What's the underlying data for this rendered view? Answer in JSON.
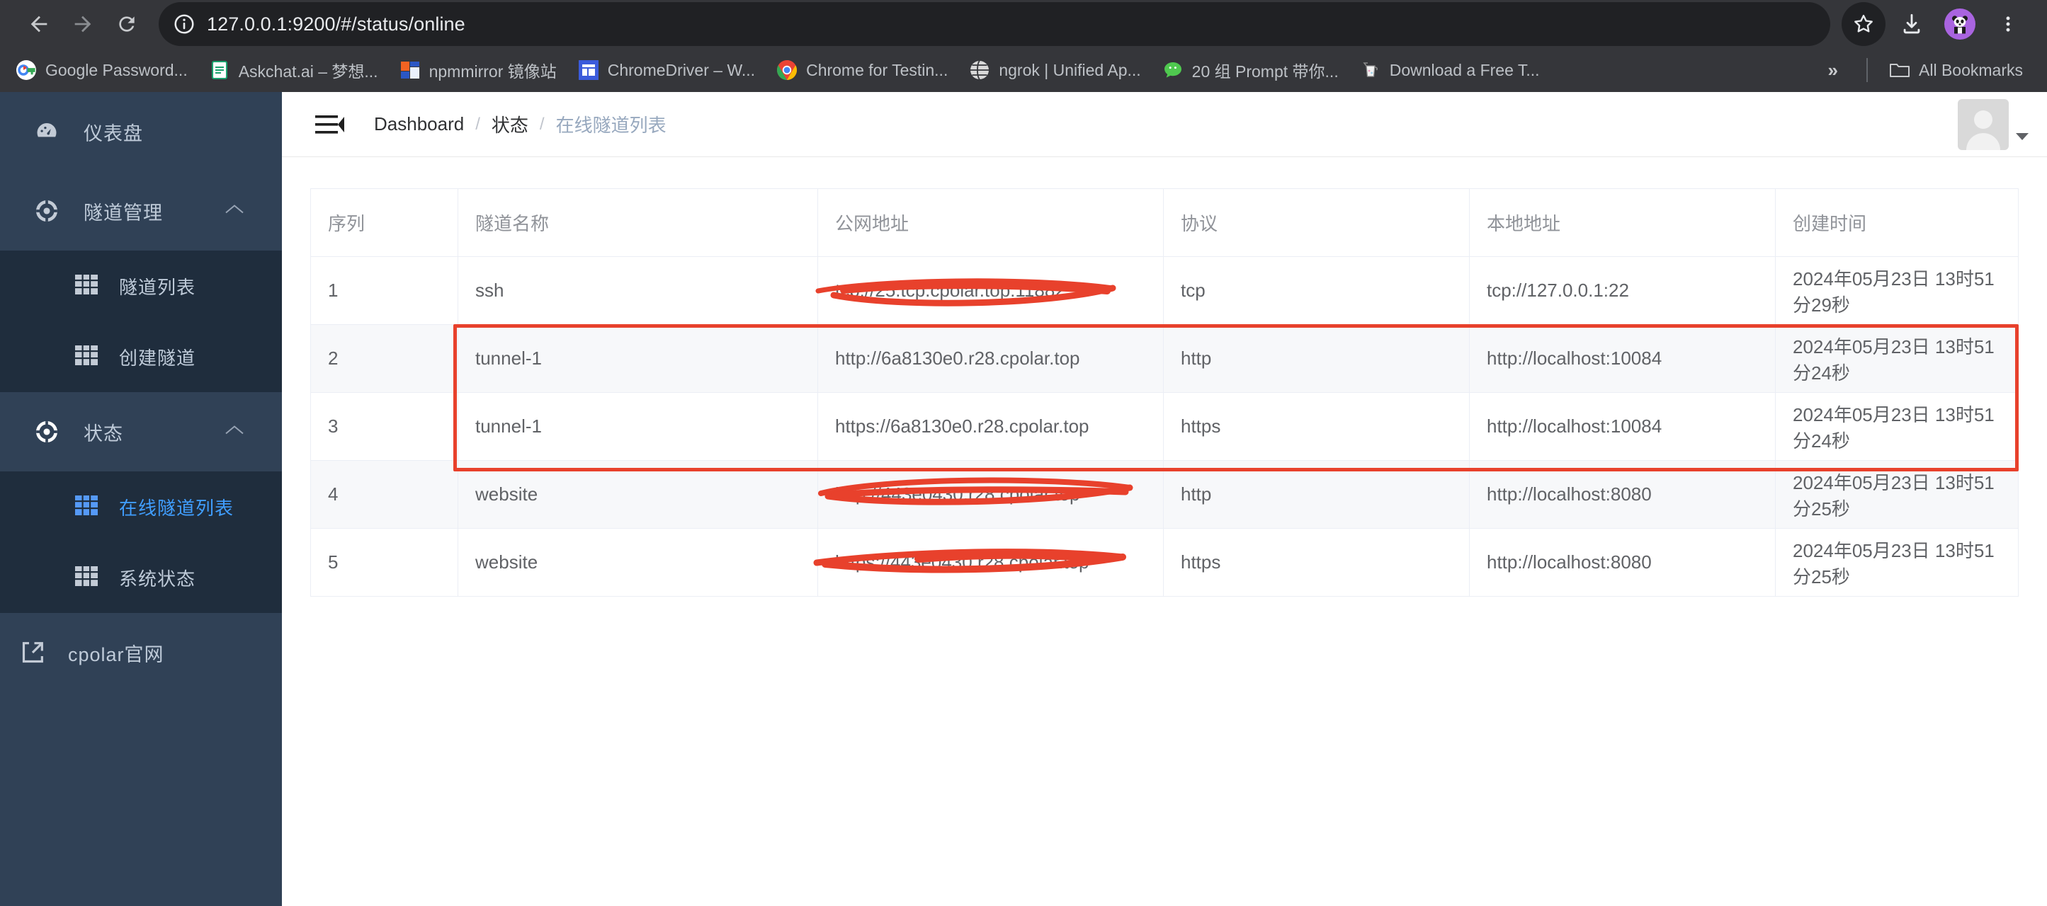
{
  "browser": {
    "url": "127.0.0.1:9200/#/status/online",
    "back_label": "Back",
    "forward_label": "Forward",
    "reload_label": "Reload",
    "site_info_label": "View site information",
    "bookmark_star_label": "Bookmark this tab",
    "downloads_label": "Downloads",
    "profile_label": "Profile",
    "menu_label": "Customize and control Google Chrome",
    "bookmarks": [
      {
        "label": "Google Password...",
        "icon": "google-password-icon"
      },
      {
        "label": "Askchat.ai – 梦想...",
        "icon": "askchat-doc-icon"
      },
      {
        "label": "npmmirror 镜像站",
        "icon": "npmmirror-icon"
      },
      {
        "label": "ChromeDriver – W...",
        "icon": "chromedriver-icon"
      },
      {
        "label": "Chrome for Testin...",
        "icon": "chrome-icon"
      },
      {
        "label": "ngrok | Unified Ap...",
        "icon": "ngrok-globe-icon"
      },
      {
        "label": "20 组 Prompt 带你...",
        "icon": "wechat-icon"
      },
      {
        "label": "Download a Free T...",
        "icon": "teapot-icon"
      }
    ],
    "overflow_label": "»",
    "all_bookmarks_label": "All Bookmarks"
  },
  "sidebar": {
    "dashboard": {
      "label": "仪表盘",
      "icon": "dashboard-gauge-icon"
    },
    "groups": [
      {
        "label": "隧道管理",
        "icon": "tunnel-manage-icon",
        "expanded": true,
        "arrow": "chevron-up-icon",
        "items": [
          {
            "label": "隧道列表",
            "icon": "grid-icon",
            "active": false
          },
          {
            "label": "创建隧道",
            "icon": "grid-icon",
            "active": false
          }
        ]
      },
      {
        "label": "状态",
        "icon": "status-icon",
        "expanded": true,
        "arrow": "chevron-up-icon",
        "items": [
          {
            "label": "在线隧道列表",
            "icon": "grid-icon",
            "active": true
          },
          {
            "label": "系统状态",
            "icon": "grid-icon",
            "active": false
          }
        ]
      }
    ],
    "external": {
      "label": "cpolar官网",
      "icon": "external-link-icon"
    }
  },
  "topbar": {
    "menu_toggle": "hamburger-fold-icon",
    "breadcrumbs": [
      {
        "label": "Dashboard",
        "current": false
      },
      {
        "label": "状态",
        "current": false
      },
      {
        "label": "在线隧道列表",
        "current": true
      }
    ],
    "separator": "/",
    "avatar_label": "user-avatar"
  },
  "table": {
    "columns": [
      "序列",
      "隧道名称",
      "公网地址",
      "协议",
      "本地地址",
      "创建时间"
    ],
    "rows": [
      {
        "seq": "1",
        "name": "ssh",
        "public": "tcp://25.tcp.cpolar.top:11882",
        "public_redacted": true,
        "protocol": "tcp",
        "local": "tcp://127.0.0.1:22",
        "created": "2024年05月23日 13时51分29秒",
        "striped": false,
        "highlighted": false
      },
      {
        "seq": "2",
        "name": "tunnel-1",
        "public": "http://6a8130e0.r28.cpolar.top",
        "public_redacted": false,
        "protocol": "http",
        "local": "http://localhost:10084",
        "created": "2024年05月23日 13时51分24秒",
        "striped": true,
        "highlighted": true
      },
      {
        "seq": "3",
        "name": "tunnel-1",
        "public": "https://6a8130e0.r28.cpolar.top",
        "public_redacted": false,
        "protocol": "https",
        "local": "http://localhost:10084",
        "created": "2024年05月23日 13时51分24秒",
        "striped": false,
        "highlighted": true
      },
      {
        "seq": "4",
        "name": "website",
        "public": "http://443e0430.r28.cpolar.top",
        "public_redacted": true,
        "protocol": "http",
        "local": "http://localhost:8080",
        "created": "2024年05月23日 13时51分25秒",
        "striped": true,
        "highlighted": false
      },
      {
        "seq": "5",
        "name": "website",
        "public": "https://443e0430.r28.cpolar.top",
        "public_redacted": true,
        "protocol": "https",
        "local": "http://localhost:8080",
        "created": "2024年05月23日 13时51分25秒",
        "striped": false,
        "highlighted": false
      }
    ]
  },
  "colors": {
    "sidebar_bg": "#304156",
    "sidebar_sub_bg": "#1f2d3d",
    "accent_blue": "#409eff",
    "annotation_red": "#e8412c",
    "chrome_bg": "#35363a",
    "omnibox_bg": "#202124"
  }
}
